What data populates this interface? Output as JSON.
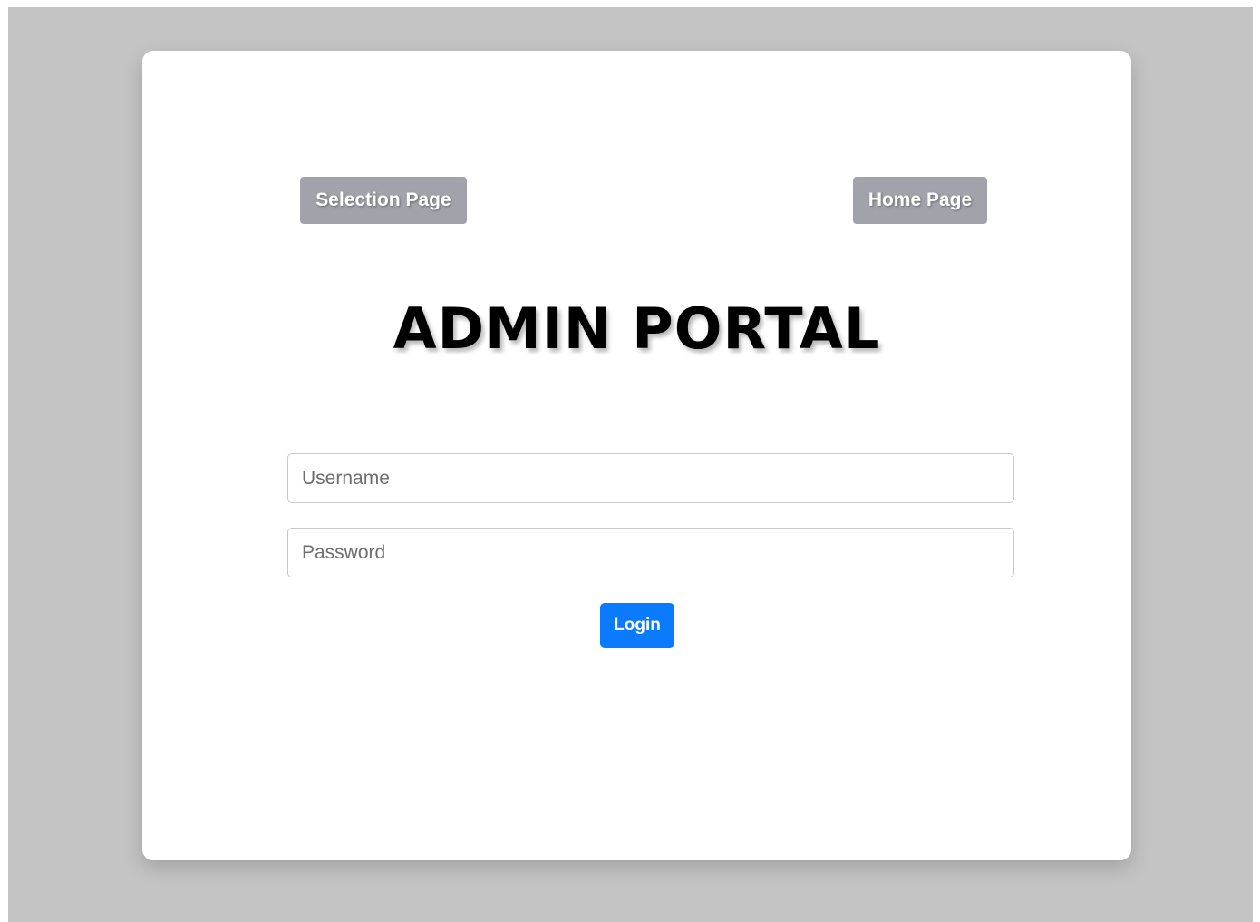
{
  "nav": {
    "selection_label": "Selection Page",
    "home_label": "Home Page"
  },
  "page": {
    "title": "ADMIN PORTAL"
  },
  "form": {
    "username": {
      "value": "",
      "placeholder": "Username"
    },
    "password": {
      "value": "",
      "placeholder": "Password"
    },
    "login_label": "Login"
  },
  "colors": {
    "backdrop": "#c4c4c4",
    "card": "#ffffff",
    "nav_button": "#a2a2ab",
    "login_button": "#0a7bff"
  }
}
